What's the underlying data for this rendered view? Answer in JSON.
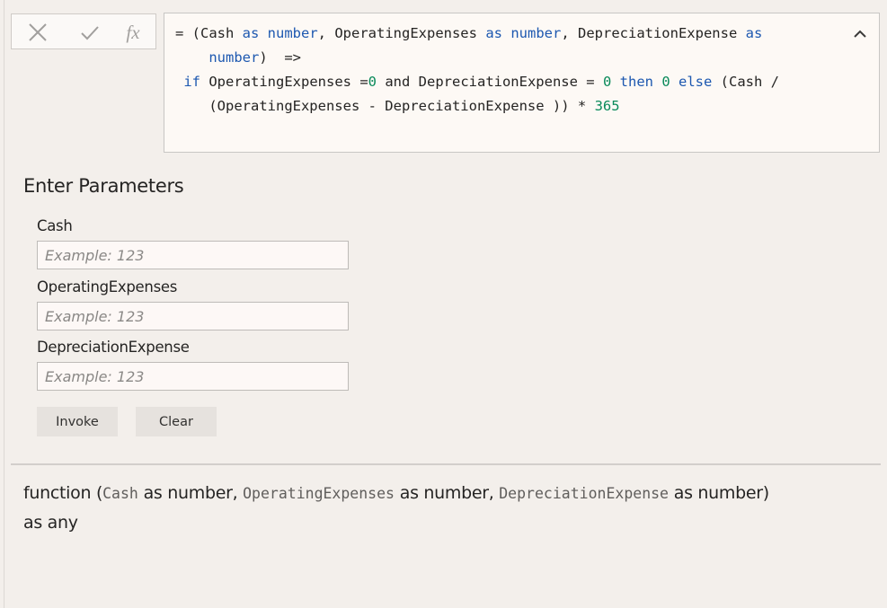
{
  "formula_bar": {
    "cancel_icon": "close-icon",
    "commit_icon": "checkmark-icon",
    "fx_label": "fx",
    "collapse_icon": "chevron-up-icon",
    "lines": [
      [
        {
          "t": "= (Cash ",
          "c": "plain"
        },
        {
          "t": "as",
          "c": "kw"
        },
        {
          "t": " ",
          "c": "plain"
        },
        {
          "t": "number",
          "c": "kw"
        },
        {
          "t": ", OperatingExpenses ",
          "c": "plain"
        },
        {
          "t": "as",
          "c": "kw"
        },
        {
          "t": " ",
          "c": "plain"
        },
        {
          "t": "number",
          "c": "kw"
        },
        {
          "t": ", DepreciationExpense ",
          "c": "plain"
        },
        {
          "t": "as",
          "c": "kw"
        }
      ],
      [
        {
          "t": "    ",
          "c": "plain"
        },
        {
          "t": "number",
          "c": "kw"
        },
        {
          "t": ")  =>",
          "c": "plain"
        }
      ],
      [
        {
          "t": " ",
          "c": "plain"
        },
        {
          "t": "if",
          "c": "kw"
        },
        {
          "t": " OperatingExpenses =",
          "c": "plain"
        },
        {
          "t": "0",
          "c": "num"
        },
        {
          "t": " and DepreciationExpense = ",
          "c": "plain"
        },
        {
          "t": "0",
          "c": "num"
        },
        {
          "t": " ",
          "c": "plain"
        },
        {
          "t": "then",
          "c": "kw"
        },
        {
          "t": " ",
          "c": "plain"
        },
        {
          "t": "0",
          "c": "num"
        },
        {
          "t": " ",
          "c": "plain"
        },
        {
          "t": "else",
          "c": "kw"
        },
        {
          "t": " (Cash /",
          "c": "plain"
        }
      ],
      [
        {
          "t": "    (OperatingExpenses - DepreciationExpense )) * ",
          "c": "plain"
        },
        {
          "t": "365",
          "c": "num"
        }
      ]
    ]
  },
  "parameters": {
    "title": "Enter Parameters",
    "fields": [
      {
        "label": "Cash",
        "placeholder": "Example: 123",
        "value": ""
      },
      {
        "label": "OperatingExpenses",
        "placeholder": "Example: 123",
        "value": ""
      },
      {
        "label": "DepreciationExpense",
        "placeholder": "Example: 123",
        "value": ""
      }
    ],
    "invoke_label": "Invoke",
    "clear_label": "Clear"
  },
  "signature": {
    "prefix": "function (",
    "params": [
      {
        "name": "Cash",
        "type": " as number"
      },
      {
        "name": "OperatingExpenses",
        "type": " as number"
      },
      {
        "name": "DepreciationExpense",
        "type": " as number"
      }
    ],
    "separator": ", ",
    "suffix": ")",
    "return": "as any"
  },
  "colors": {
    "keyword": "#1d58b0",
    "number": "#0a8a5a",
    "background": "#f3efeb"
  }
}
